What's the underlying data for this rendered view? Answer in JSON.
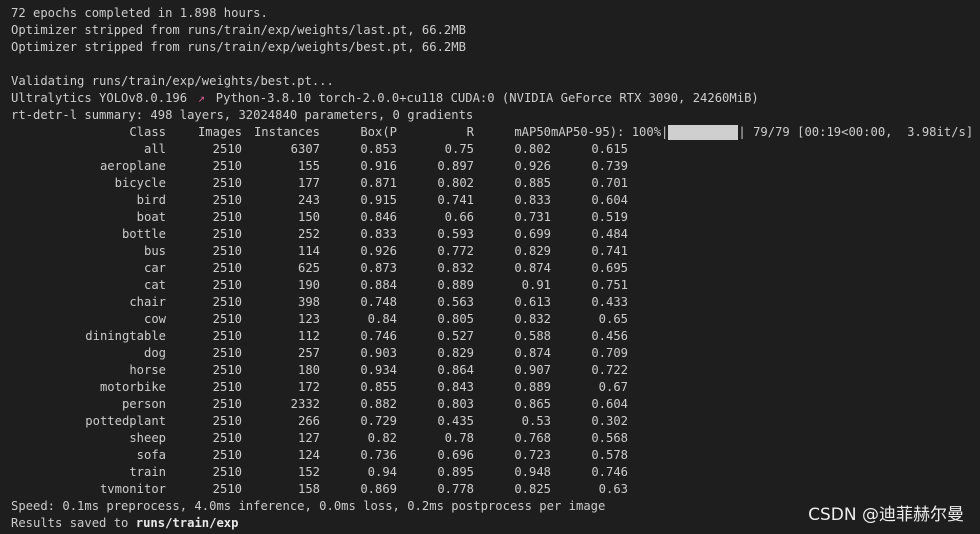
{
  "log": {
    "line1": "72 epochs completed in 1.898 hours.",
    "line2": "Optimizer stripped from runs/train/exp/weights/last.pt, 66.2MB",
    "line3": "Optimizer stripped from runs/train/exp/weights/best.pt, 66.2MB",
    "line4": "Validating runs/train/exp/weights/best.pt...",
    "line5_prefix": "Ultralytics YOLOv8.0.196 ",
    "line5_icon": "rocket-icon",
    "line5_suffix": " Python-3.8.10 torch-2.0.0+cu118 CUDA:0 (NVIDIA GeForce RTX 3090, 24260MiB)",
    "line6": "rt-detr-l summary: 498 layers, 32024840 parameters, 0 gradients"
  },
  "table": {
    "headers": {
      "class": "Class",
      "images": "Images",
      "instances": "Instances",
      "p": "Box(P",
      "r": "R",
      "map50": "mAP50",
      "map5095": "mAP50-95): 100%|"
    },
    "progress": {
      "percent": 100,
      "tail": "| 79/79 [00:19<00:00,  3.98it/s]"
    },
    "rows": [
      {
        "class": "all",
        "images": "2510",
        "instances": "6307",
        "p": "0.853",
        "r": "0.75",
        "map50": "0.802",
        "map5095": "0.615"
      },
      {
        "class": "aeroplane",
        "images": "2510",
        "instances": "155",
        "p": "0.916",
        "r": "0.897",
        "map50": "0.926",
        "map5095": "0.739"
      },
      {
        "class": "bicycle",
        "images": "2510",
        "instances": "177",
        "p": "0.871",
        "r": "0.802",
        "map50": "0.885",
        "map5095": "0.701"
      },
      {
        "class": "bird",
        "images": "2510",
        "instances": "243",
        "p": "0.915",
        "r": "0.741",
        "map50": "0.833",
        "map5095": "0.604"
      },
      {
        "class": "boat",
        "images": "2510",
        "instances": "150",
        "p": "0.846",
        "r": "0.66",
        "map50": "0.731",
        "map5095": "0.519"
      },
      {
        "class": "bottle",
        "images": "2510",
        "instances": "252",
        "p": "0.833",
        "r": "0.593",
        "map50": "0.699",
        "map5095": "0.484"
      },
      {
        "class": "bus",
        "images": "2510",
        "instances": "114",
        "p": "0.926",
        "r": "0.772",
        "map50": "0.829",
        "map5095": "0.741"
      },
      {
        "class": "car",
        "images": "2510",
        "instances": "625",
        "p": "0.873",
        "r": "0.832",
        "map50": "0.874",
        "map5095": "0.695"
      },
      {
        "class": "cat",
        "images": "2510",
        "instances": "190",
        "p": "0.884",
        "r": "0.889",
        "map50": "0.91",
        "map5095": "0.751"
      },
      {
        "class": "chair",
        "images": "2510",
        "instances": "398",
        "p": "0.748",
        "r": "0.563",
        "map50": "0.613",
        "map5095": "0.433"
      },
      {
        "class": "cow",
        "images": "2510",
        "instances": "123",
        "p": "0.84",
        "r": "0.805",
        "map50": "0.832",
        "map5095": "0.65"
      },
      {
        "class": "diningtable",
        "images": "2510",
        "instances": "112",
        "p": "0.746",
        "r": "0.527",
        "map50": "0.588",
        "map5095": "0.456"
      },
      {
        "class": "dog",
        "images": "2510",
        "instances": "257",
        "p": "0.903",
        "r": "0.829",
        "map50": "0.874",
        "map5095": "0.709"
      },
      {
        "class": "horse",
        "images": "2510",
        "instances": "180",
        "p": "0.934",
        "r": "0.864",
        "map50": "0.907",
        "map5095": "0.722"
      },
      {
        "class": "motorbike",
        "images": "2510",
        "instances": "172",
        "p": "0.855",
        "r": "0.843",
        "map50": "0.889",
        "map5095": "0.67"
      },
      {
        "class": "person",
        "images": "2510",
        "instances": "2332",
        "p": "0.882",
        "r": "0.803",
        "map50": "0.865",
        "map5095": "0.604"
      },
      {
        "class": "pottedplant",
        "images": "2510",
        "instances": "266",
        "p": "0.729",
        "r": "0.435",
        "map50": "0.53",
        "map5095": "0.302"
      },
      {
        "class": "sheep",
        "images": "2510",
        "instances": "127",
        "p": "0.82",
        "r": "0.78",
        "map50": "0.768",
        "map5095": "0.568"
      },
      {
        "class": "sofa",
        "images": "2510",
        "instances": "124",
        "p": "0.736",
        "r": "0.696",
        "map50": "0.723",
        "map5095": "0.578"
      },
      {
        "class": "train",
        "images": "2510",
        "instances": "152",
        "p": "0.94",
        "r": "0.895",
        "map50": "0.948",
        "map5095": "0.746"
      },
      {
        "class": "tvmonitor",
        "images": "2510",
        "instances": "158",
        "p": "0.869",
        "r": "0.778",
        "map50": "0.825",
        "map5095": "0.63"
      }
    ]
  },
  "footer": {
    "speed": "Speed: 0.1ms preprocess, 4.0ms inference, 0.0ms loss, 0.2ms postprocess per image",
    "results_prefix": "Results saved to ",
    "results_path": "runs/train/exp"
  },
  "watermark": "CSDN @迪菲赫尔曼",
  "colors": {
    "background": "#1e1e1e",
    "text": "#cccccc",
    "progress_fill": "#cfcfcf",
    "rocket": "#d45a8a"
  }
}
